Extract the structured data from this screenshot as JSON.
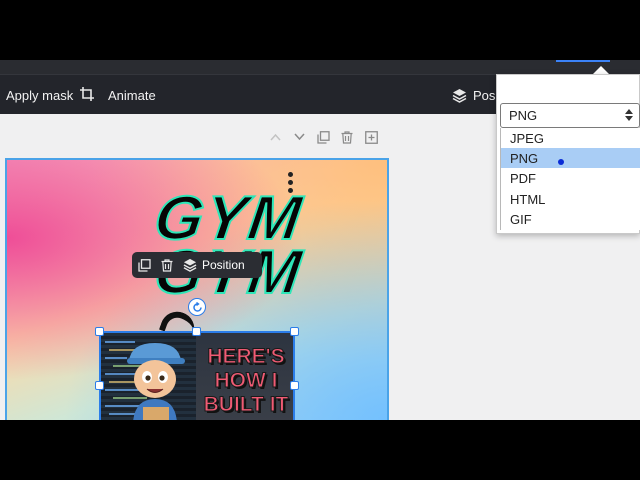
{
  "toolbar": {
    "apply_mask_label": "Apply mask",
    "animate_label": "Animate",
    "position_label": "Posit"
  },
  "design": {
    "heading_line1": "GYM",
    "heading_line2": "GYM",
    "thumbnail_text": "HERE'S HOW I BUILT IT"
  },
  "floating_toolbar": {
    "position_label": "Position"
  },
  "export_dropdown": {
    "selected_value": "PNG",
    "options": [
      {
        "label": "JPEG",
        "highlighted": false
      },
      {
        "label": "PNG",
        "highlighted": true
      },
      {
        "label": "PDF",
        "highlighted": false
      },
      {
        "label": "HTML",
        "highlighted": false
      },
      {
        "label": "GIF",
        "highlighted": false
      }
    ]
  },
  "colors": {
    "toolbar_bg": "#23252b",
    "selection_accent": "#2b7de9",
    "highlight_option": "#a9cdf5",
    "heading_outline": "#2ee6b8"
  },
  "icons": [
    "crop-icon",
    "layers-icon",
    "chevron-up-icon",
    "chevron-down-icon",
    "duplicate-icon",
    "trash-icon",
    "add-page-icon",
    "rotate-icon",
    "more-vertical-icon",
    "select-arrows-icon"
  ]
}
